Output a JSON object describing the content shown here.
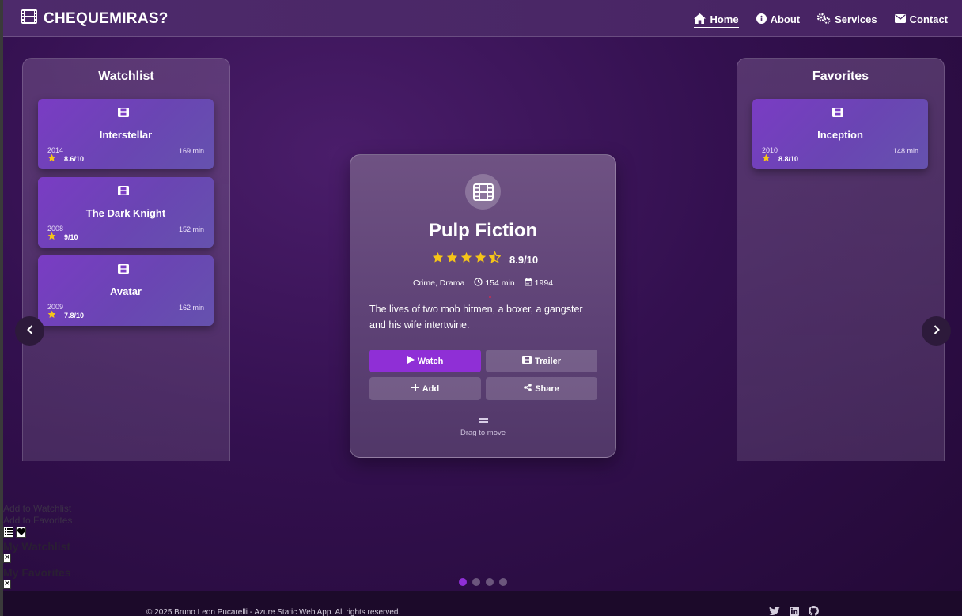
{
  "brand": {
    "name": "CHEQUEMIRAS?",
    "icon": "film-icon"
  },
  "nav": {
    "items": [
      {
        "label": "Home",
        "icon": "home-icon",
        "active": true
      },
      {
        "label": "About",
        "icon": "info-icon"
      },
      {
        "label": "Services",
        "icon": "cogs-icon"
      },
      {
        "label": "Contact",
        "icon": "envelope-icon"
      }
    ]
  },
  "watchlist": {
    "title": "Watchlist",
    "items": [
      {
        "title": "Interstellar",
        "year": "2014",
        "rating": "8.6/10",
        "duration": "169 min"
      },
      {
        "title": "The Dark Knight",
        "year": "2008",
        "rating": "9/10",
        "duration": "152 min"
      },
      {
        "title": "Avatar",
        "year": "2009",
        "rating": "7.8/10",
        "duration": "162 min"
      }
    ]
  },
  "favorites": {
    "title": "Favorites",
    "items": [
      {
        "title": "Inception",
        "year": "2010",
        "rating": "8.8/10",
        "duration": "148 min"
      }
    ]
  },
  "featured": {
    "title": "Pulp Fiction",
    "stars": 4.5,
    "rating": "8.9/10",
    "genre": "Crime, Drama",
    "duration": "154 min",
    "year": "1994",
    "description": "The lives of two mob hitmen, a boxer, a gangster and his wife intertwine.",
    "buttons": {
      "watch": "Watch",
      "trailer": "Trailer",
      "add": "Add",
      "share": "Share"
    },
    "drag_hint": "Drag to move"
  },
  "fallback": {
    "add_watchlist": "Add to Watchlist",
    "add_favorites": "Add to Favorites",
    "my_watchlist": "My Watchlist",
    "my_favorites": "My Favorites",
    "close": "✕"
  },
  "carousel": {
    "slides": 4,
    "active": 0
  },
  "footer": {
    "copyright": "© 2025 Bruno Leon Pucarelli - Azure Static Web App. All rights reserved.",
    "social": [
      "twitter-icon",
      "linkedin-icon",
      "github-icon"
    ]
  },
  "colors": {
    "accent": "#8f2fd6",
    "star": "#f5c518",
    "background": "#2a0a44"
  }
}
